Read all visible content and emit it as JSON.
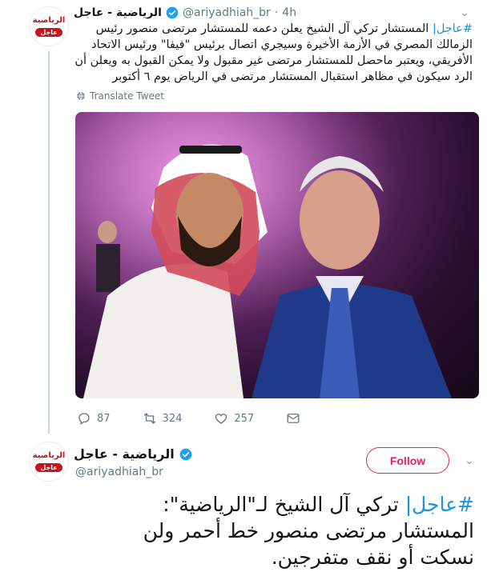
{
  "reply_tweet": {
    "avatar_logo_text": "الرياضية",
    "avatar_logo_sub": "عاجل",
    "display_name": "الرياضية - عاجل",
    "handle": "@ariyadhiah_br",
    "separator": "·",
    "time": "4h",
    "hashtag": "#عاجل|",
    "text": " المستشار تركي آل الشيخ يعلن دعمه للمستشار مرتضى منصور رئيس الزمالك المصري في الأزمة الأخيرة وسيجري اتصال برئيس \"فيفا\" ورئيس الاتحاد الأفريقي، ويعتبر ماحصل للمستشار مرتضى غير مقبول ولا يمكن القبول به ويعلن أن الرد سيكون في مظاهر استقبال المستشار مرتضى في الرياض يوم ٦ أكتوبر",
    "translate_label": "Translate Tweet",
    "actions": {
      "replies": "87",
      "retweets": "324",
      "likes": "257"
    }
  },
  "main_tweet": {
    "avatar_logo_text": "الرياضية",
    "avatar_logo_sub": "عاجل",
    "display_name": "الرياضية - عاجل",
    "handle": "@ariyadhiah_br",
    "follow_label": "Follow",
    "hashtag": "#عاجل|",
    "text": " تركي آل الشيخ لـ\"الرياضية\": المستشار مرتضى منصور خط أحمر ولن نسكت أو نقف متفرجين."
  },
  "colors": {
    "link": "#1b95e0",
    "muted": "#657786",
    "follow": "#e0245e",
    "brand_red": "#c4161c",
    "verified": "#1da1f2"
  },
  "icons": [
    "verified-badge-icon",
    "chevron-down-icon",
    "globe-icon",
    "reply-icon",
    "retweet-icon",
    "like-icon",
    "dm-icon"
  ]
}
